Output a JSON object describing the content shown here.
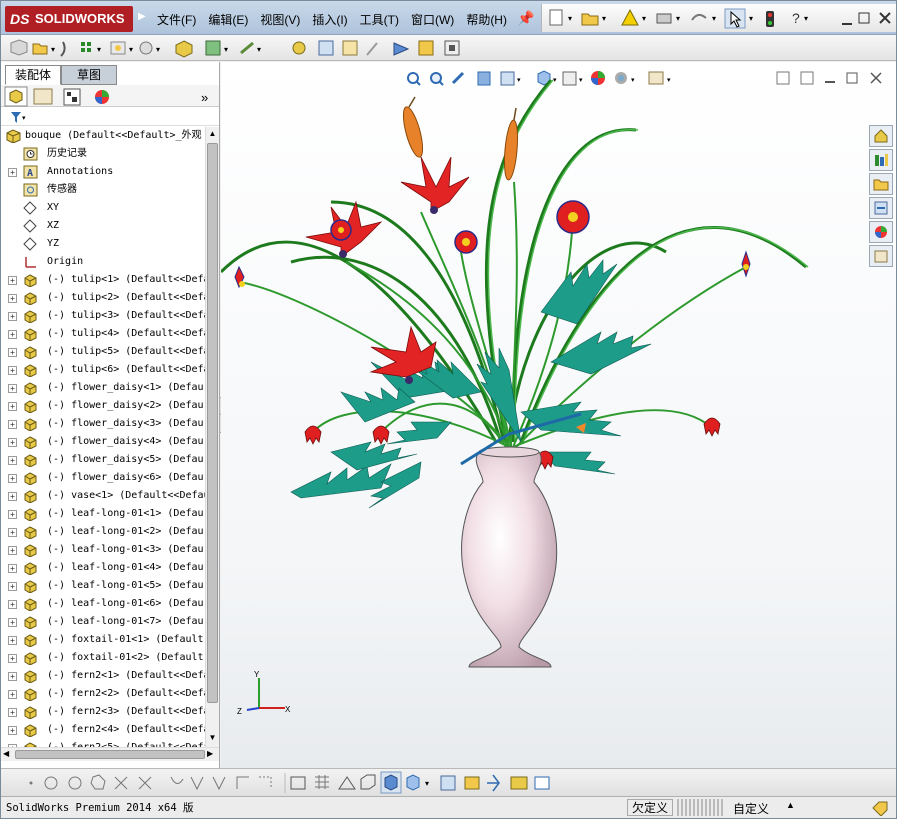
{
  "titlebar": {
    "logo_ds": "DS",
    "logo_text": "SOLIDWORKS",
    "menus": [
      "文件(F)",
      "编辑(E)",
      "视图(V)",
      "插入(I)",
      "工具(T)",
      "窗口(W)",
      "帮助(H)"
    ],
    "help_glyph": "?"
  },
  "panel": {
    "tab_assembly": "装配体",
    "tab_sketch": "草图",
    "root_label": "bouque  (Default<<Default>_外观",
    "items": [
      {
        "label": "历史记录",
        "icon": "history-icon",
        "expand": false
      },
      {
        "label": "Annotations",
        "icon": "annotations-icon",
        "expand": true
      },
      {
        "label": "传感器",
        "icon": "sensor-icon",
        "expand": false
      },
      {
        "label": "XY",
        "icon": "plane-icon",
        "expand": false
      },
      {
        "label": "XZ",
        "icon": "plane-icon",
        "expand": false
      },
      {
        "label": "YZ",
        "icon": "plane-icon",
        "expand": false
      },
      {
        "label": "Origin",
        "icon": "origin-icon",
        "expand": false
      },
      {
        "label": "(-) tulip<1> (Default<<Defa",
        "icon": "part-icon",
        "expand": true
      },
      {
        "label": "(-) tulip<2> (Default<<Defa",
        "icon": "part-icon",
        "expand": true
      },
      {
        "label": "(-) tulip<3> (Default<<Defa",
        "icon": "part-icon",
        "expand": true
      },
      {
        "label": "(-) tulip<4> (Default<<Defa",
        "icon": "part-icon",
        "expand": true
      },
      {
        "label": "(-) tulip<5> (Default<<Defa",
        "icon": "part-icon",
        "expand": true
      },
      {
        "label": "(-) tulip<6> (Default<<Defa",
        "icon": "part-icon",
        "expand": true
      },
      {
        "label": "(-) flower_daisy<1> (Defau",
        "icon": "part-icon",
        "expand": true
      },
      {
        "label": "(-) flower_daisy<2> (Defau",
        "icon": "part-icon",
        "expand": true
      },
      {
        "label": "(-) flower_daisy<3> (Defau",
        "icon": "part-icon",
        "expand": true
      },
      {
        "label": "(-) flower_daisy<4> (Defau",
        "icon": "part-icon",
        "expand": true
      },
      {
        "label": "(-) flower_daisy<5> (Defau",
        "icon": "part-icon",
        "expand": true
      },
      {
        "label": "(-) flower_daisy<6> (Defau",
        "icon": "part-icon",
        "expand": true
      },
      {
        "label": "(-) vase<1> (Default<<Defau",
        "icon": "part-icon",
        "expand": true
      },
      {
        "label": "(-) leaf-long-01<1> (Defau",
        "icon": "part-icon",
        "expand": true
      },
      {
        "label": "(-) leaf-long-01<2> (Defau",
        "icon": "part-icon",
        "expand": true
      },
      {
        "label": "(-) leaf-long-01<3> (Defau",
        "icon": "part-icon",
        "expand": true
      },
      {
        "label": "(-) leaf-long-01<4> (Defau",
        "icon": "part-icon",
        "expand": true
      },
      {
        "label": "(-) leaf-long-01<5> (Defau",
        "icon": "part-icon",
        "expand": true
      },
      {
        "label": "(-) leaf-long-01<6> (Defau",
        "icon": "part-icon",
        "expand": true
      },
      {
        "label": "(-) leaf-long-01<7> (Defau",
        "icon": "part-icon",
        "expand": true
      },
      {
        "label": "(-) foxtail-01<1> (Default",
        "icon": "part-icon",
        "expand": true
      },
      {
        "label": "(-) foxtail-01<2> (Default",
        "icon": "part-icon",
        "expand": true
      },
      {
        "label": "(-) fern2<1> (Default<<Defa",
        "icon": "part-icon",
        "expand": true
      },
      {
        "label": "(-) fern2<2> (Default<<Defa",
        "icon": "part-icon",
        "expand": true
      },
      {
        "label": "(-) fern2<3> (Default<<Defa",
        "icon": "part-icon",
        "expand": true
      },
      {
        "label": "(-) fern2<4> (Default<<Defa",
        "icon": "part-icon",
        "expand": true
      },
      {
        "label": "(-) fern2<5> (Default<<Defa",
        "icon": "part-icon",
        "expand": true
      }
    ]
  },
  "triad": {
    "x": "X",
    "y": "Y",
    "z": "Z"
  },
  "status": {
    "product": "SolidWorks Premium 2014 x64 版",
    "state": "欠定义",
    "custom": "自定义"
  },
  "colors": {
    "brand": "#b01f24",
    "accent": "#2e6bb3"
  }
}
